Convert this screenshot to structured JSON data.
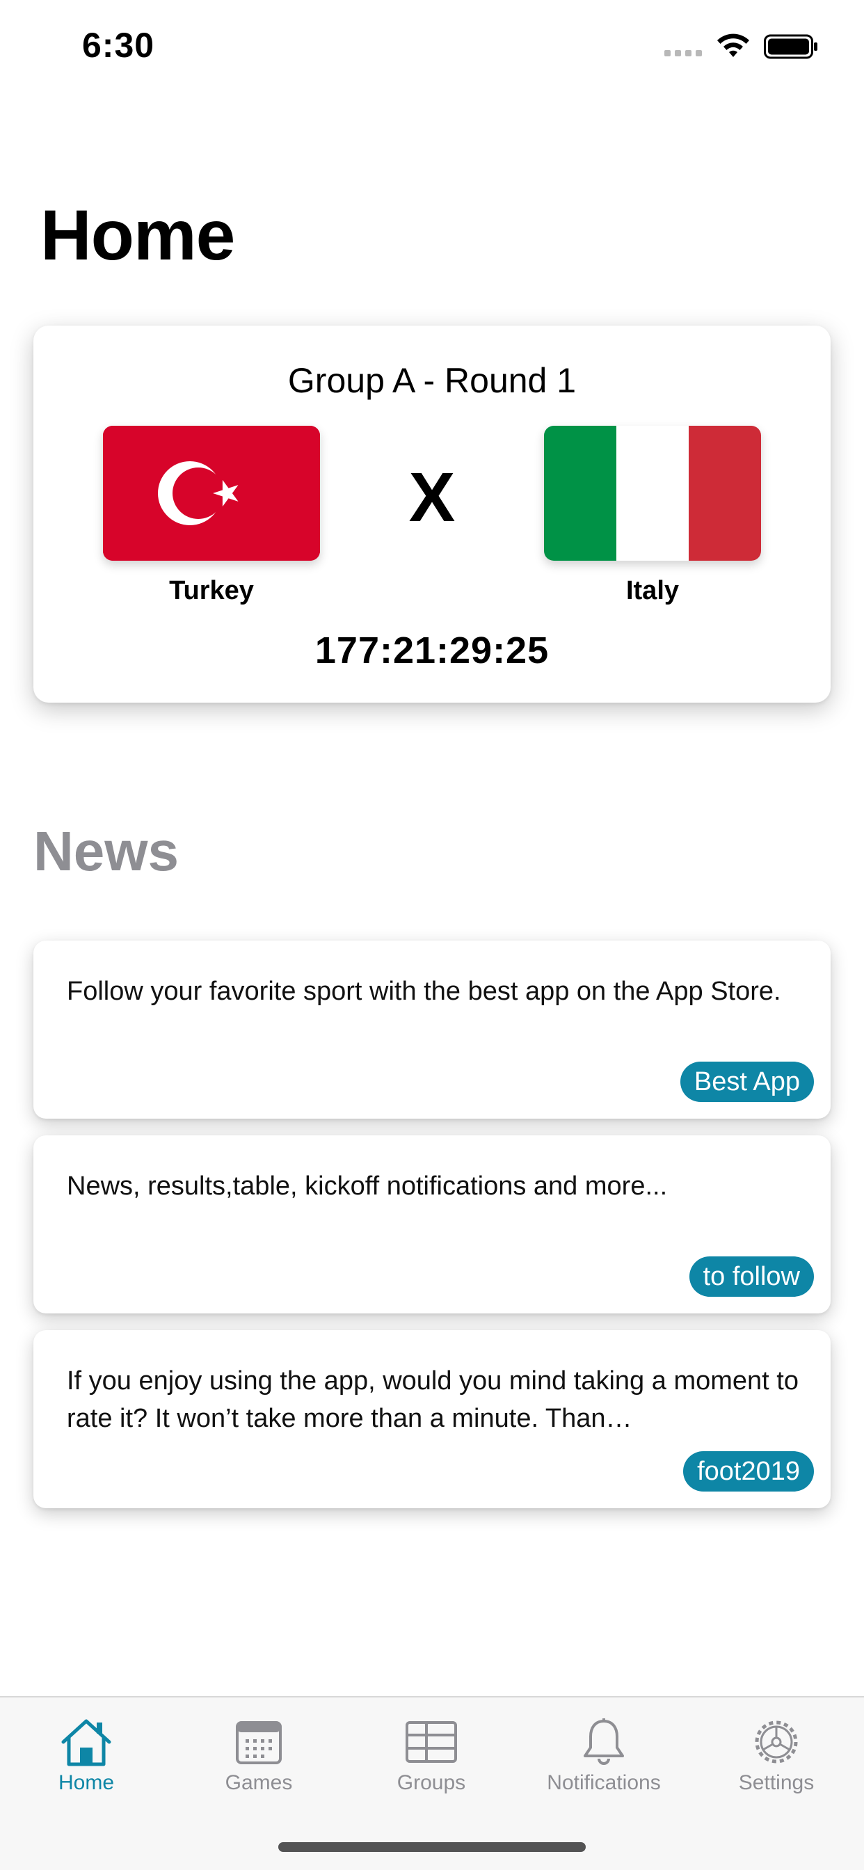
{
  "status_bar": {
    "time": "6:30"
  },
  "page": {
    "title": "Home"
  },
  "match": {
    "round": "Group A - Round 1",
    "home_team": "Turkey",
    "away_team": "Italy",
    "versus": "X",
    "countdown": "177:21:29:25",
    "flags": {
      "turkey_red": "#d7042a",
      "italy_green": "#009246",
      "italy_white": "#ffffff",
      "italy_red": "#ce2b37"
    }
  },
  "news": {
    "heading": "News",
    "items": [
      {
        "text": "Follow your favorite sport with the best app on the App Store.",
        "tag": "Best App"
      },
      {
        "text": "News, results,table, kickoff notifications and more...",
        "tag": "to follow"
      },
      {
        "text": "If you enjoy using the app, would you mind taking a moment to rate it? It won’t take more than a minute. Than…",
        "tag": "foot2019"
      }
    ]
  },
  "tab_bar": {
    "items": [
      {
        "label": "Home",
        "icon": "house-icon",
        "active": true
      },
      {
        "label": "Games",
        "icon": "calendar-icon",
        "active": false
      },
      {
        "label": "Groups",
        "icon": "table-grid-icon",
        "active": false
      },
      {
        "label": "Notifications",
        "icon": "bell-icon",
        "active": false
      },
      {
        "label": "Settings",
        "icon": "gear-icon",
        "active": false
      }
    ]
  },
  "colors": {
    "accent": "#0e86a6",
    "inactive": "#8e8e93"
  }
}
